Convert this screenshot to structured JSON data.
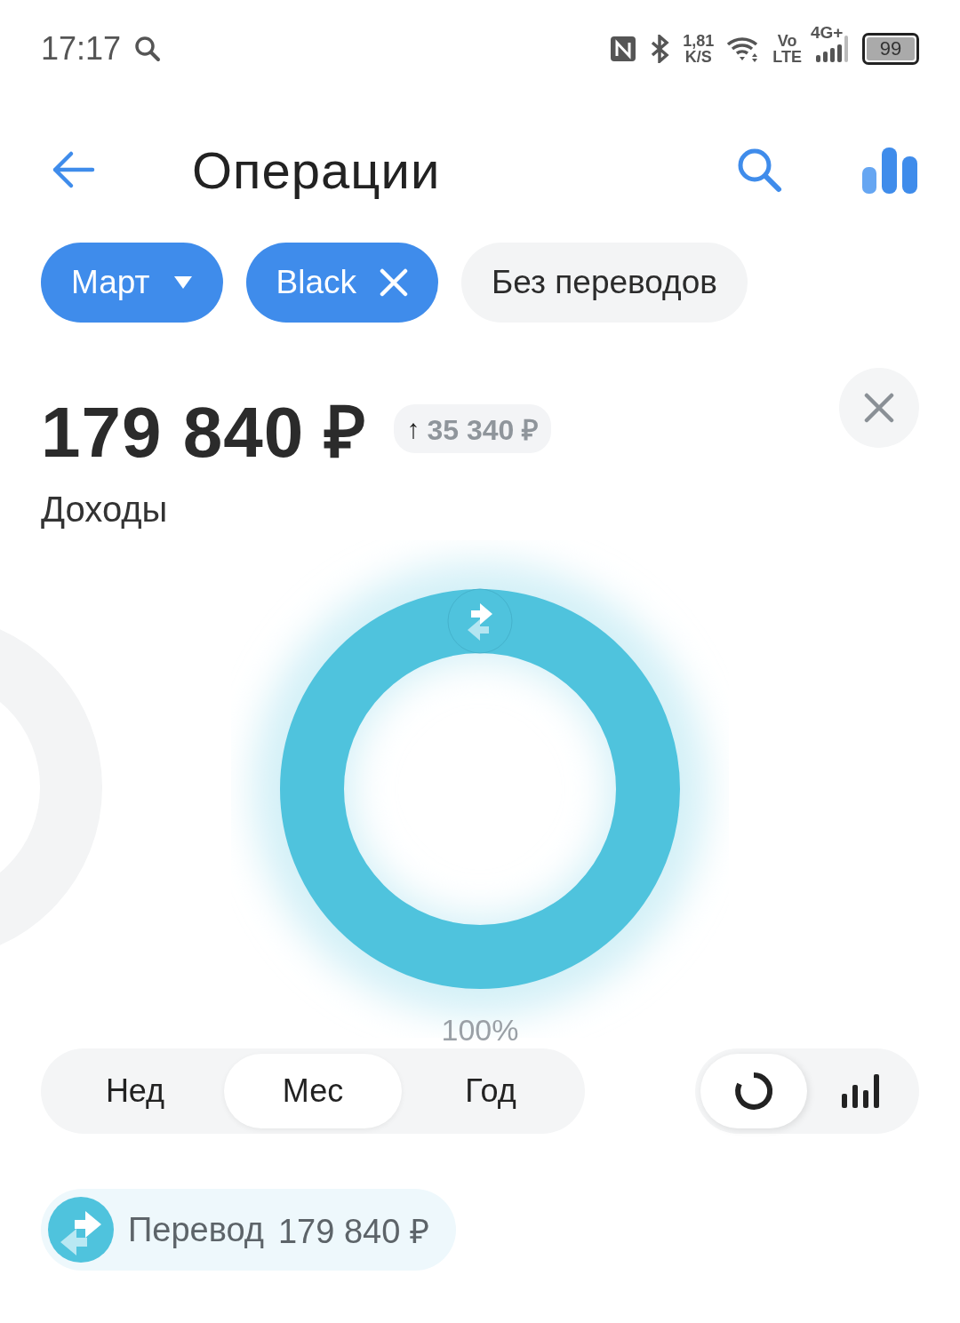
{
  "status_bar": {
    "time": "17:17",
    "speed_value": "1,81",
    "speed_unit": "K/S",
    "volte_top": "Vo",
    "volte_bottom": "LTE",
    "network": "4G+",
    "battery": "99"
  },
  "header": {
    "title": "Операции"
  },
  "filters": [
    {
      "label": "Март",
      "kind": "dropdown",
      "selected": true
    },
    {
      "label": "Black",
      "kind": "removable",
      "selected": true
    },
    {
      "label": "Без переводов",
      "kind": "toggle",
      "selected": false
    }
  ],
  "summary": {
    "amount": "179 840 ₽",
    "change_arrow": "↑",
    "change": "35 340 ₽",
    "label": "Доходы"
  },
  "chart": {
    "percent_label": "100%"
  },
  "periods": [
    {
      "label": "Нед",
      "selected": false
    },
    {
      "label": "Мес",
      "selected": true
    },
    {
      "label": "Год",
      "selected": false
    }
  ],
  "views": [
    {
      "kind": "donut",
      "selected": true
    },
    {
      "kind": "bars",
      "selected": false
    }
  ],
  "legend": [
    {
      "name": "Перевод",
      "amount": "179 840 ₽",
      "color": "#4fc3dd"
    }
  ]
}
